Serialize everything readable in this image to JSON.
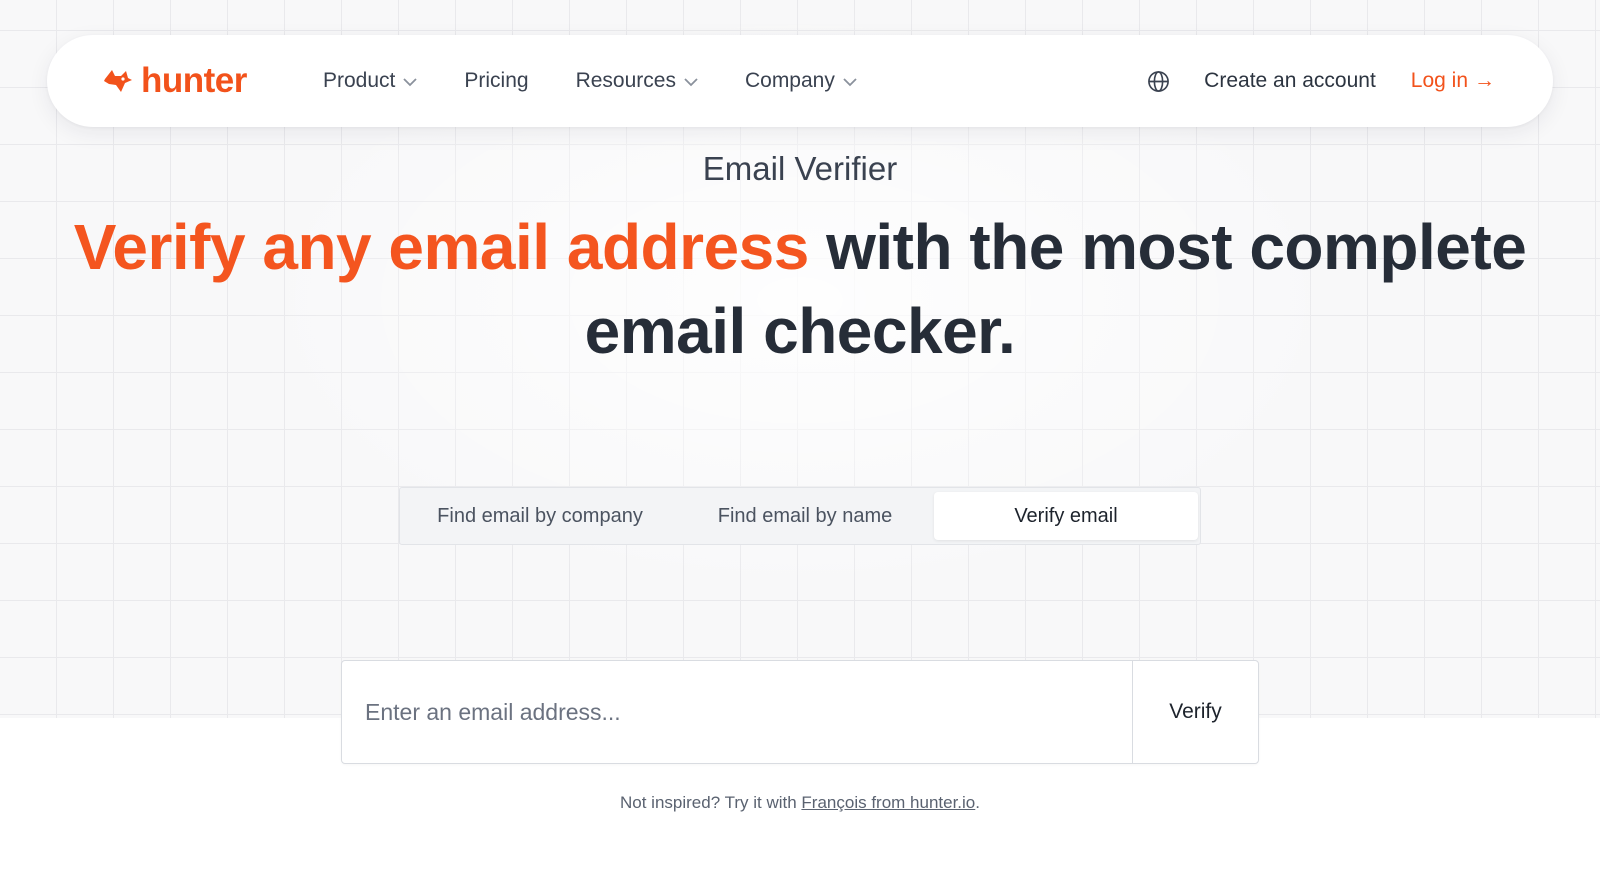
{
  "brand": {
    "name": "hunter",
    "color": "#f2521b",
    "logo_icon": "fox-head-icon"
  },
  "nav": {
    "items": [
      {
        "label": "Product",
        "has_dropdown": true
      },
      {
        "label": "Pricing",
        "has_dropdown": false
      },
      {
        "label": "Resources",
        "has_dropdown": true
      },
      {
        "label": "Company",
        "has_dropdown": true
      }
    ],
    "language_icon": "globe-icon",
    "create_account": "Create an account",
    "login": "Log in",
    "login_arrow": "→"
  },
  "hero": {
    "eyebrow": "Email Verifier",
    "headline_accent": "Verify any email address",
    "headline_rest": " with the most complete email checker.",
    "accent_color": "#f4551f"
  },
  "tabs": [
    {
      "label": "Find email by company",
      "active": false
    },
    {
      "label": "Find email by name",
      "active": false
    },
    {
      "label": "Verify email",
      "active": true
    }
  ],
  "verify": {
    "placeholder": "Enter an email address...",
    "value": "",
    "button": "Verify"
  },
  "hint": {
    "prefix": "Not inspired? Try it with ",
    "link": "François from hunter.io",
    "suffix": "."
  }
}
